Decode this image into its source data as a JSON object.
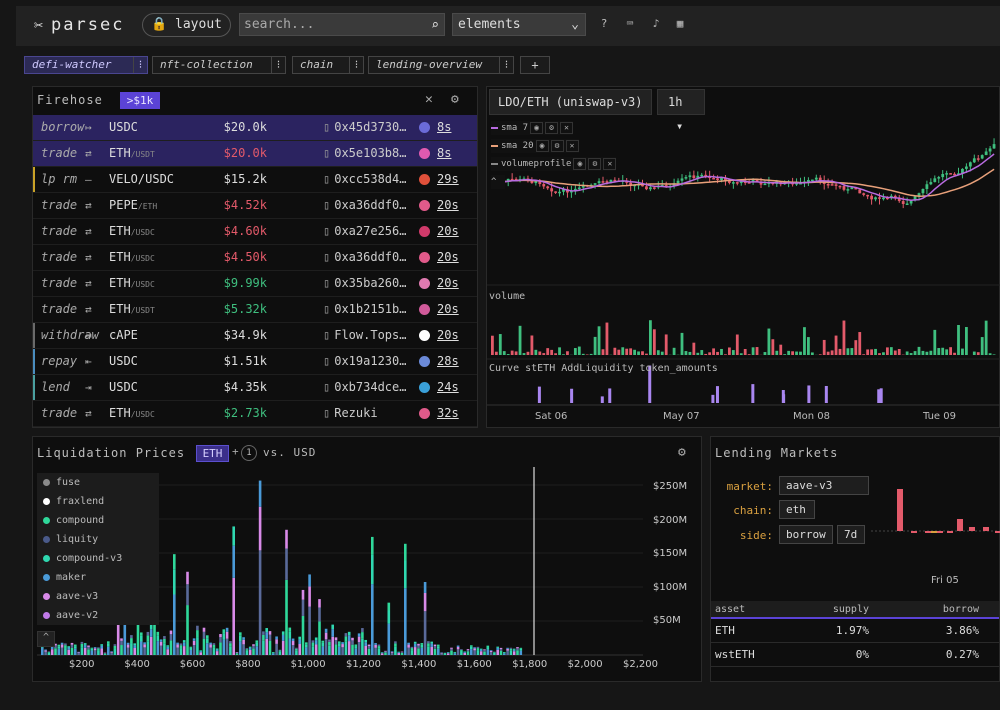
{
  "app": {
    "logo": "parsec",
    "layout_label": "layout",
    "search_placeholder": "search...",
    "elements_select": "elements"
  },
  "tabs": [
    {
      "label": "defi-watcher",
      "active": true
    },
    {
      "label": "nft-collection",
      "active": false
    },
    {
      "label": "chain",
      "active": false
    },
    {
      "label": "lending-overview",
      "active": false
    }
  ],
  "tab_add": "+",
  "firehose": {
    "title": "Firehose",
    "filter": ">$1k",
    "rows": [
      {
        "type": "borrow",
        "arrow": "↦",
        "pair": "USDC",
        "sub": "",
        "amount": "$20.0k",
        "color": "w",
        "addr": "0x45d3730…",
        "age": "8s",
        "chain": "#6b6bd8",
        "hl": true,
        "edge": ""
      },
      {
        "type": "trade",
        "arrow": "⇄",
        "pair": "ETH",
        "sub": "/USDT",
        "amount": "$20.0k",
        "color": "r",
        "addr": "0x5e103b8…",
        "age": "8s",
        "chain": "#e05ab0",
        "hl": true,
        "edge": ""
      },
      {
        "type": "lp rm",
        "arrow": "—",
        "pair": "VELO/USDC",
        "sub": "",
        "amount": "$15.2k",
        "color": "w",
        "addr": "0xcc538d4…",
        "age": "29s",
        "chain": "#e0503a",
        "hl": false,
        "edge": "lp"
      },
      {
        "type": "trade",
        "arrow": "⇄",
        "pair": "PEPE",
        "sub": "/ETH",
        "amount": "$4.52k",
        "color": "r",
        "addr": "0xa36ddf0…",
        "age": "20s",
        "chain": "#e05a8a",
        "hl": false,
        "edge": ""
      },
      {
        "type": "trade",
        "arrow": "⇄",
        "pair": "ETH",
        "sub": "/USDC",
        "amount": "$4.60k",
        "color": "r",
        "addr": "0xa27e256…",
        "age": "20s",
        "chain": "#d03a6a",
        "hl": false,
        "edge": ""
      },
      {
        "type": "trade",
        "arrow": "⇄",
        "pair": "ETH",
        "sub": "/USDC",
        "amount": "$4.50k",
        "color": "r",
        "addr": "0xa36ddf0…",
        "age": "20s",
        "chain": "#e05a8a",
        "hl": false,
        "edge": ""
      },
      {
        "type": "trade",
        "arrow": "⇄",
        "pair": "ETH",
        "sub": "/USDC",
        "amount": "$9.99k",
        "color": "g",
        "addr": "0x35ba260…",
        "age": "20s",
        "chain": "#e07ab0",
        "hl": false,
        "edge": ""
      },
      {
        "type": "trade",
        "arrow": "⇄",
        "pair": "ETH",
        "sub": "/USDT",
        "amount": "$5.32k",
        "color": "g",
        "addr": "0x1b2151b…",
        "age": "20s",
        "chain": "#d05a9a",
        "hl": false,
        "edge": ""
      },
      {
        "type": "withdraw",
        "arrow": "↤",
        "pair": "cAPE",
        "sub": "",
        "amount": "$34.9k",
        "color": "w",
        "addr": "Flow.Tops…",
        "age": "20s",
        "chain": "#ffffff",
        "hl": false,
        "edge": "wd"
      },
      {
        "type": "repay",
        "arrow": "⇤",
        "pair": "USDC",
        "sub": "",
        "amount": "$1.51k",
        "color": "w",
        "addr": "0x19a1230…",
        "age": "28s",
        "chain": "#6b8ad8",
        "hl": false,
        "edge": "rp"
      },
      {
        "type": "lend",
        "arrow": "⇥",
        "pair": "USDC",
        "sub": "",
        "amount": "$4.35k",
        "color": "w",
        "addr": "0xb734dce…",
        "age": "24s",
        "chain": "#3aa0d8",
        "hl": false,
        "edge": "ld"
      },
      {
        "type": "trade",
        "arrow": "⇄",
        "pair": "ETH",
        "sub": "/USDC",
        "amount": "$2.73k",
        "color": "g",
        "addr": "Rezuki",
        "age": "32s",
        "chain": "#e05a8a",
        "hl": false,
        "edge": ""
      }
    ]
  },
  "chart": {
    "pair": "LDO/ETH (uniswap-v3)",
    "interval": "1h",
    "indicators": [
      {
        "label": "sma 7",
        "color": "#b86be0"
      },
      {
        "label": "sma 20",
        "color": "#e8a07a"
      },
      {
        "label": "volumeprofile",
        "color": "#888888"
      }
    ],
    "volume_label": "volume",
    "curve_label": "Curve stETH AddLiquidity token_amounts",
    "xticks": [
      "Sat 06",
      "May 07",
      "Mon 08",
      "Tue 09"
    ]
  },
  "liquidation": {
    "title": "Liquidation Prices",
    "asset": "ETH",
    "plus": "+",
    "count": "1",
    "vs": "vs. USD",
    "legend": [
      {
        "label": "fuse",
        "color": "#8a8a8a"
      },
      {
        "label": "fraxlend",
        "color": "#ffffff"
      },
      {
        "label": "compound",
        "color": "#2fd89a"
      },
      {
        "label": "liquity",
        "color": "#4a5a8a"
      },
      {
        "label": "compound-v3",
        "color": "#2fd8b0"
      },
      {
        "label": "maker",
        "color": "#4a9ad8"
      },
      {
        "label": "aave-v3",
        "color": "#d88ae8"
      },
      {
        "label": "aave-v2",
        "color": "#c07ae8"
      }
    ],
    "yticks": [
      "$250M",
      "$200M",
      "$150M",
      "$100M",
      "$50M"
    ],
    "xticks": [
      "$200",
      "$400",
      "$600",
      "$800",
      "$1,000",
      "$1,200",
      "$1,400",
      "$1,600",
      "$1,800",
      "$2,000",
      "$2,200"
    ]
  },
  "lending": {
    "title": "Lending Markets",
    "fields": [
      {
        "label": "market:",
        "value": "aave-v3"
      },
      {
        "label": "chain:",
        "value": "eth"
      },
      {
        "label": "side:",
        "value": "borrow",
        "extra": "7d"
      }
    ],
    "x_tick": "Fri 05",
    "table": {
      "headers": [
        "asset",
        "supply",
        "borrow"
      ],
      "rows": [
        [
          "ETH",
          "1.97%",
          "3.86%"
        ],
        [
          "wstETH",
          "0%",
          "0.27%"
        ]
      ]
    }
  },
  "colors": {
    "accent": "#5b43d6",
    "up": "#3fbf7f",
    "down": "#e35a6a"
  }
}
